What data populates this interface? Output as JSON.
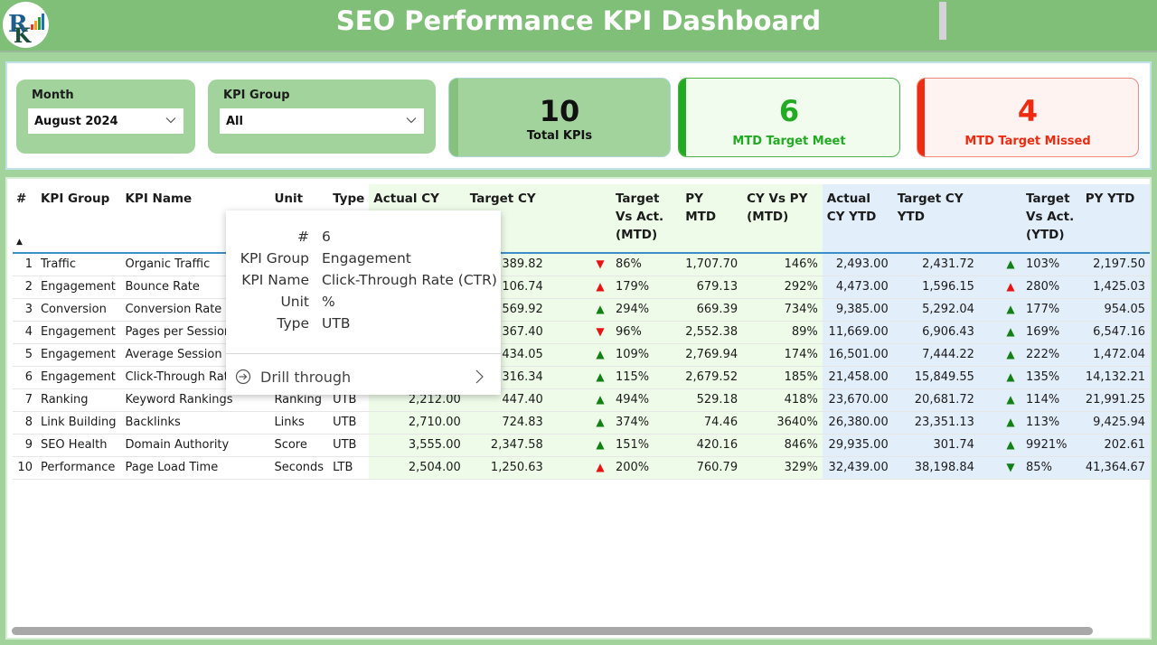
{
  "header": {
    "title": "SEO Performance KPI Dashboard",
    "logo_icon": "company-logo"
  },
  "filters": {
    "month": {
      "label": "Month",
      "value": "August 2024"
    },
    "kpi_group": {
      "label": "KPI Group",
      "value": "All"
    }
  },
  "cards": {
    "total": {
      "value": "10",
      "label": "Total KPIs"
    },
    "meet": {
      "value": "6",
      "label": "MTD Target Meet",
      "color": "#22aa22"
    },
    "missed": {
      "value": "4",
      "label": "MTD Target Missed",
      "color": "#ee2b10"
    }
  },
  "table": {
    "columns": {
      "num": "#",
      "group": "KPI Group",
      "name": "KPI Name",
      "unit": "Unit",
      "type": "Type",
      "actual_mtd": "Actual CY MTD",
      "target_mtd": "Target CY MTD",
      "tva_mtd": "Target Vs Act. (MTD)",
      "py_mtd": "PY MTD",
      "cyvspy_mtd": "CY Vs PY (MTD)",
      "actual_ytd": "Actual CY YTD",
      "target_ytd": "Target CY YTD",
      "tva_ytd": "Target Vs Act. (YTD)",
      "py_ytd": "PY YTD"
    },
    "sort_indicator": "ascending",
    "rows": [
      {
        "num": "1",
        "group": "Traffic",
        "name": "Organic Traffic",
        "unit": "",
        "type": "",
        "actual_mtd": "",
        "target_mtd": "389.82",
        "mtd_icon": "down-red",
        "tva_mtd": "86%",
        "py_mtd": "1,707.70",
        "cyvspy_mtd": "146%",
        "actual_ytd": "2,493.00",
        "target_ytd": "2,431.72",
        "ytd_icon": "up-green",
        "tva_ytd": "103%",
        "py_ytd": "2,197.50"
      },
      {
        "num": "2",
        "group": "Engagement",
        "name": "Bounce Rate",
        "unit": "",
        "type": "",
        "actual_mtd": "",
        "target_mtd": "106.74",
        "mtd_icon": "up-red",
        "tva_mtd": "179%",
        "py_mtd": "679.13",
        "cyvspy_mtd": "292%",
        "actual_ytd": "4,473.00",
        "target_ytd": "1,596.15",
        "ytd_icon": "up-red",
        "tva_ytd": "280%",
        "py_ytd": "1,425.03"
      },
      {
        "num": "3",
        "group": "Conversion",
        "name": "Conversion Rate",
        "unit": "",
        "type": "",
        "actual_mtd": "",
        "target_mtd": "569.92",
        "mtd_icon": "up-green",
        "tva_mtd": "294%",
        "py_mtd": "669.39",
        "cyvspy_mtd": "734%",
        "actual_ytd": "9,385.00",
        "target_ytd": "5,292.04",
        "ytd_icon": "up-green",
        "tva_ytd": "177%",
        "py_ytd": "954.05"
      },
      {
        "num": "4",
        "group": "Engagement",
        "name": "Pages per Session",
        "unit": "",
        "type": "",
        "actual_mtd": "",
        "target_mtd": "367.40",
        "mtd_icon": "down-red",
        "tva_mtd": "96%",
        "py_mtd": "2,552.38",
        "cyvspy_mtd": "89%",
        "actual_ytd": "11,669.00",
        "target_ytd": "6,906.43",
        "ytd_icon": "up-green",
        "tva_ytd": "169%",
        "py_ytd": "6,547.16"
      },
      {
        "num": "5",
        "group": "Engagement",
        "name": "Average Session Du",
        "unit": "",
        "type": "",
        "actual_mtd": "",
        "target_mtd": "434.05",
        "mtd_icon": "up-green",
        "tva_mtd": "109%",
        "py_mtd": "2,769.94",
        "cyvspy_mtd": "174%",
        "actual_ytd": "16,501.00",
        "target_ytd": "7,444.22",
        "ytd_icon": "up-green",
        "tva_ytd": "222%",
        "py_ytd": "1,472.04"
      },
      {
        "num": "6",
        "group": "Engagement",
        "name": "Click-Through Rate",
        "unit": "",
        "type": "",
        "actual_mtd": "",
        "target_mtd": "316.34",
        "mtd_icon": "up-green",
        "tva_mtd": "115%",
        "py_mtd": "2,679.52",
        "cyvspy_mtd": "185%",
        "actual_ytd": "21,458.00",
        "target_ytd": "15,849.55",
        "ytd_icon": "up-green",
        "tva_ytd": "135%",
        "py_ytd": "14,132.21"
      },
      {
        "num": "7",
        "group": "Ranking",
        "name": "Keyword Rankings",
        "unit": "Ranking",
        "type": "UTB",
        "actual_mtd": "2,212.00",
        "target_mtd": "447.40",
        "mtd_icon": "up-green",
        "tva_mtd": "494%",
        "py_mtd": "529.18",
        "cyvspy_mtd": "418%",
        "actual_ytd": "23,670.00",
        "target_ytd": "20,681.72",
        "ytd_icon": "up-green",
        "tva_ytd": "114%",
        "py_ytd": "21,991.25"
      },
      {
        "num": "8",
        "group": "Link Building",
        "name": "Backlinks",
        "unit": "Links",
        "type": "UTB",
        "actual_mtd": "2,710.00",
        "target_mtd": "724.83",
        "mtd_icon": "up-green",
        "tva_mtd": "374%",
        "py_mtd": "74.46",
        "cyvspy_mtd": "3640%",
        "actual_ytd": "26,380.00",
        "target_ytd": "23,351.13",
        "ytd_icon": "up-green",
        "tva_ytd": "113%",
        "py_ytd": "9,425.94"
      },
      {
        "num": "9",
        "group": "SEO Health",
        "name": "Domain Authority",
        "unit": "Score",
        "type": "UTB",
        "actual_mtd": "3,555.00",
        "target_mtd": "2,347.58",
        "mtd_icon": "up-green",
        "tva_mtd": "151%",
        "py_mtd": "420.16",
        "cyvspy_mtd": "846%",
        "actual_ytd": "29,935.00",
        "target_ytd": "301.74",
        "ytd_icon": "up-green",
        "tva_ytd": "9921%",
        "py_ytd": "202.61"
      },
      {
        "num": "10",
        "group": "Performance",
        "name": "Page Load Time",
        "unit": "Seconds",
        "type": "LTB",
        "actual_mtd": "2,504.00",
        "target_mtd": "1,250.63",
        "mtd_icon": "up-red",
        "tva_mtd": "200%",
        "py_mtd": "760.79",
        "cyvspy_mtd": "329%",
        "actual_ytd": "32,439.00",
        "target_ytd": "38,198.84",
        "ytd_icon": "down-green",
        "tva_ytd": "85%",
        "py_ytd": "41,364.67"
      }
    ]
  },
  "tooltip": {
    "fields": [
      {
        "key": "#",
        "value": "6"
      },
      {
        "key": "KPI Group",
        "value": "Engagement"
      },
      {
        "key": "KPI Name",
        "value": "Click-Through Rate (CTR)"
      },
      {
        "key": "Unit",
        "value": "%"
      },
      {
        "key": "Type",
        "value": "UTB"
      }
    ],
    "drill_label": "Drill through"
  },
  "colors": {
    "header_bg": "#80bf78",
    "page_bg": "#a3d39c",
    "up_green": "#128012",
    "red": "#e81414",
    "mtd_band": "#eefbe8",
    "ytd_band": "#e3eefb"
  }
}
